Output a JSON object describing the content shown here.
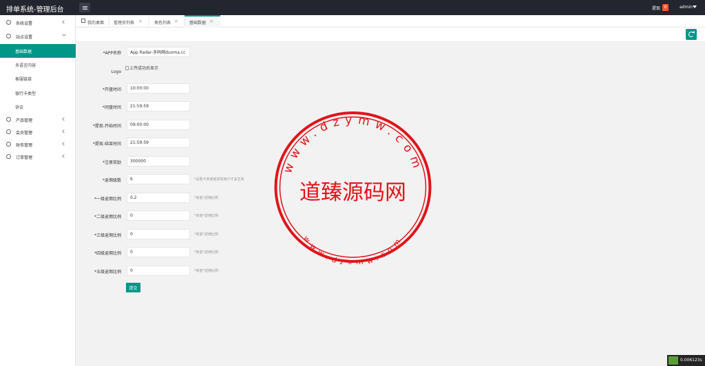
{
  "header": {
    "title": "排单系统-管理后台",
    "withdraw_label": "提现",
    "withdraw_count": "0",
    "user": "admin"
  },
  "sidebar": {
    "items": [
      {
        "label": "系统设置",
        "icon": "gear-icon"
      },
      {
        "label": "站点设置",
        "icon": "cloud-icon"
      },
      {
        "label": "产品管理",
        "icon": "product-icon"
      },
      {
        "label": "会员管理",
        "icon": "user-icon"
      },
      {
        "label": "财务管理",
        "icon": "money-icon"
      },
      {
        "label": "订单管理",
        "icon": "order-icon"
      }
    ],
    "subitems": [
      "基础数据",
      "多语言内容",
      "客服链接",
      "银行卡类型",
      "协议"
    ]
  },
  "tabs": [
    {
      "label": "我的桌面"
    },
    {
      "label": "管理员列表"
    },
    {
      "label": "角色列表"
    },
    {
      "label": "基础数据"
    }
  ],
  "form": {
    "app_name_label": "*APP名称",
    "app_name_value": "App Radar-多码网duoma.cc",
    "logo_label": "Logo",
    "logo_alt": "上传成功后显示",
    "open_time_label": "*开盘时间",
    "open_time_value": "10:00:00",
    "close_time_label": "*闭盘时间",
    "close_time_value": "21:59:59",
    "withdraw_start_label": "*提现-开始时间",
    "withdraw_start_value": "09:00:00",
    "withdraw_end_label": "*提现-结束时间",
    "withdraw_end_value": "21:59:59",
    "register_reward_label": "*注册奖励",
    "register_reward_value": "300000",
    "rebate_count_label": "*返佣级数",
    "rebate_count_value": "6",
    "rebate_count_hint": "*设置卡单或者返单用户才会生效",
    "level1_label": "*一级返佣比例",
    "level1_value": "0.2",
    "level2_label": "*二级返佣比例",
    "level2_value": "0",
    "level3_label": "*三级返佣比例",
    "level3_value": "0",
    "level4_label": "*四级返佣比例",
    "level4_value": "0",
    "level5_label": "*五级返佣比例",
    "level5_value": "0",
    "level_hint": "*商金*返佣比例",
    "submit_label": "提交"
  },
  "watermark": {
    "text": "道臻源码网",
    "top_url": "www.dzymw.com",
    "bottom_url": "www.dzymw.com",
    "color": "#e0141b"
  },
  "timing": "0.006123s",
  "colors": {
    "accent": "#009688",
    "header": "#23262e",
    "badge": "#ff5722"
  }
}
